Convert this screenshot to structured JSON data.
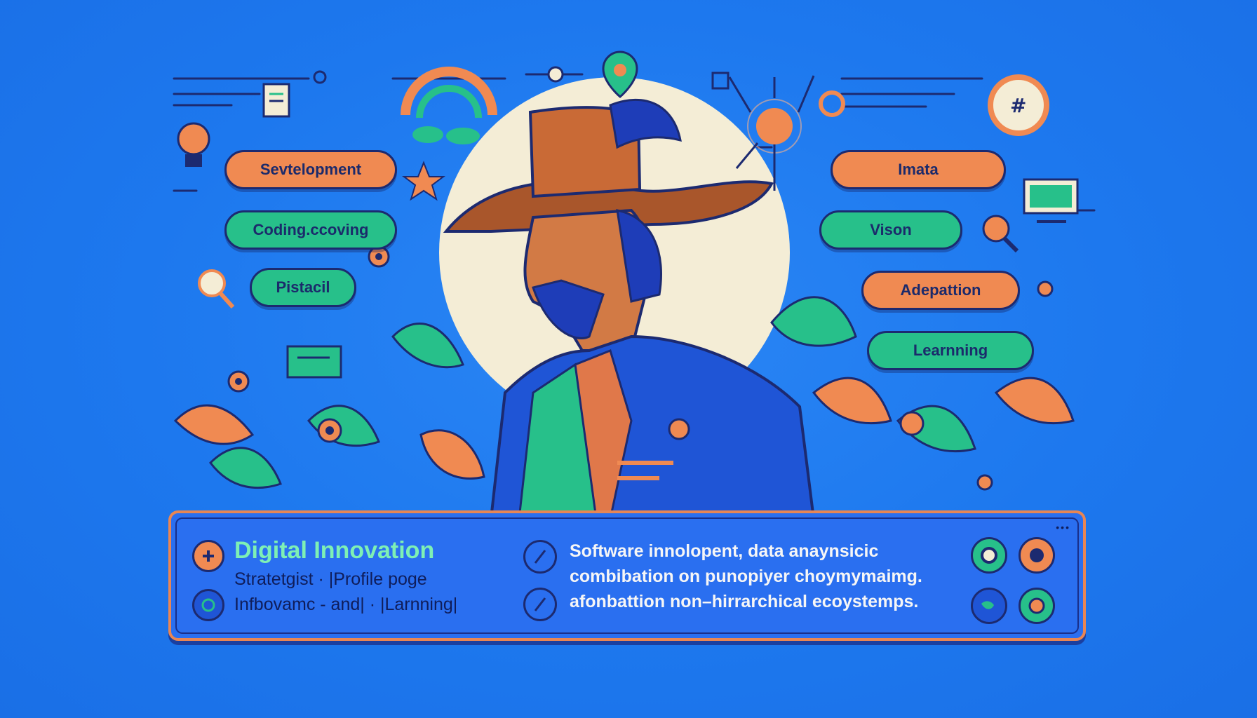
{
  "left_pills": [
    {
      "label": "Sevtelopment",
      "color": "orange"
    },
    {
      "label": "Coding.ccoving",
      "color": "green"
    },
    {
      "label": "Pistacil",
      "color": "green"
    }
  ],
  "right_pills": [
    {
      "label": "Imata",
      "color": "orange"
    },
    {
      "label": "Vison",
      "color": "green"
    },
    {
      "label": "Adepattion",
      "color": "orange"
    },
    {
      "label": "Learnning",
      "color": "green"
    }
  ],
  "profile": {
    "title": "Digital Innovation",
    "subtitle_line1": "Stratetgist · |Profile poge",
    "subtitle_line2": "Infbovamc - and| · |Larnning|",
    "description_line1": "Software innolopent,  data anaynsicic",
    "description_line2": "combibation on punopiyer choymymaimg.",
    "description_line3": "afonbattion non–hirrarchical ecoystemps."
  },
  "colors": {
    "background": "#1f7df0",
    "accent_orange": "#f08a52",
    "accent_green": "#27c08a",
    "outline_navy": "#1c2a70"
  },
  "icons": {
    "add": "plus-icon",
    "slash1": "slash-icon",
    "slash2": "slash-icon",
    "badge": "currency-badge-icon"
  }
}
